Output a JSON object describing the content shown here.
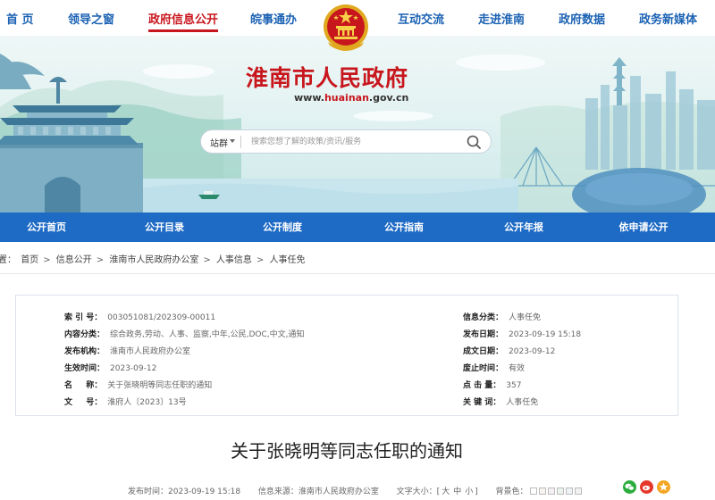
{
  "nav": {
    "items": [
      "首 页",
      "领导之窗",
      "政府信息公开",
      "皖事通办",
      "互动交流",
      "走进淮南",
      "政府数据",
      "政务新媒体"
    ],
    "active_index": 2
  },
  "site": {
    "title": "淮南市人民政府",
    "url_prefix": "www.",
    "url_highlight": "huainan",
    "url_suffix": ".gov.cn"
  },
  "search": {
    "scope": "站群",
    "placeholder": "搜索您想了解的政策/资讯/服务"
  },
  "menu": {
    "items": [
      "公开首页",
      "公开目录",
      "公开制度",
      "公开指南",
      "公开年报",
      "依申请公开"
    ]
  },
  "breadcrumb": {
    "prefix": "位置：",
    "items": [
      "首页",
      "信息公开",
      "淮南市人民政府办公室",
      "人事信息",
      "人事任免"
    ]
  },
  "info": {
    "left": [
      {
        "key": "索 引 号：",
        "value": "003051081/202309-00011"
      },
      {
        "key": "内容分类：",
        "value": "综合政务,劳动、人事、监察,中年,公民,DOC,中文,通知"
      },
      {
        "key": "发布机构：",
        "value": "淮南市人民政府办公室"
      },
      {
        "key": "生效时间：",
        "value": "2023-09-12"
      },
      {
        "key": "名 　 称：",
        "value": "关于张晓明等同志任职的通知"
      },
      {
        "key": "文 　 号：",
        "value": "淮府人〔2023〕13号"
      }
    ],
    "right": [
      {
        "key": "信息分类：",
        "value": "人事任免"
      },
      {
        "key": "发布日期：",
        "value": "2023-09-19 15:18"
      },
      {
        "key": "成文日期：",
        "value": "2023-09-12"
      },
      {
        "key": "废止时间：",
        "value": "有效"
      },
      {
        "key": "点 击 量：",
        "value": "357"
      },
      {
        "key": "关 键 词：",
        "value": "人事任免"
      }
    ]
  },
  "article": {
    "title": "关于张晓明等同志任职的通知",
    "publish_label": "发布时间：",
    "publish_time": "2023-09-19 15:18",
    "source_label": "信息来源：",
    "source": "淮南市人民政府办公室",
    "fontsize_label": "文字大小：",
    "font_sizes": [
      "大",
      "中",
      "小"
    ],
    "bg_label": "背景色：",
    "bg_colors": [
      "#ffffff",
      "#f7f3ef",
      "#f5f0f5",
      "#ecf4f0",
      "#eef2f7",
      "#f2f2f2"
    ]
  },
  "colors": {
    "brand_red": "#c8161d",
    "brand_blue": "#1e6bc5",
    "nav_blue": "#1b62b3"
  }
}
